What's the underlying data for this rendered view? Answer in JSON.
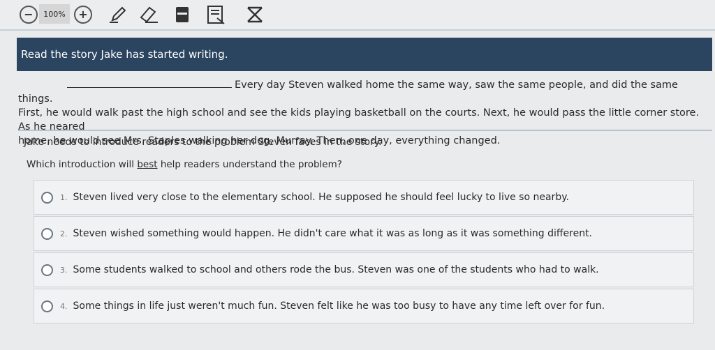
{
  "toolbar": {
    "zoom_level": "100%",
    "icons": [
      "zoom-out-icon",
      "zoom-in-icon",
      "pen-icon",
      "eraser-icon",
      "highlighter-icon",
      "notepad-icon",
      "strikethrough-icon"
    ]
  },
  "banner": {
    "text": "Read the story Jake has started writing."
  },
  "story": {
    "line1": "Every day Steven walked home the same way, saw the same people, and did the same things.",
    "line2": "First, he would walk past the high school and see the kids playing basketball on the courts. Next, he would pass the little corner store. As he neared",
    "line3": "home, he would see Mrs. Staples walking her dog, Murray. Then, one day, everything changed."
  },
  "question": {
    "intro": "Jake needs to introduce readers to the problem Steven faces in the story.",
    "prompt_before": "Which introduction will ",
    "prompt_emphasis": "best",
    "prompt_after": " help readers understand the problem?"
  },
  "options": [
    {
      "number": "1.",
      "text": "Steven lived very close to the elementary school. He supposed he should feel lucky to live so nearby."
    },
    {
      "number": "2.",
      "text": "Steven wished something would happen. He didn't care what it was as long as it was something different."
    },
    {
      "number": "3.",
      "text": "Some students walked to school and others rode the bus. Steven was one of the students who had to walk."
    },
    {
      "number": "4.",
      "text": "Some things in life just weren't much fun. Steven felt like he was too busy to have any time left over for fun."
    }
  ],
  "colors": {
    "banner": "#2b4560",
    "page_bg": "#e9ebec",
    "option_bg": "#f1f2f3"
  }
}
